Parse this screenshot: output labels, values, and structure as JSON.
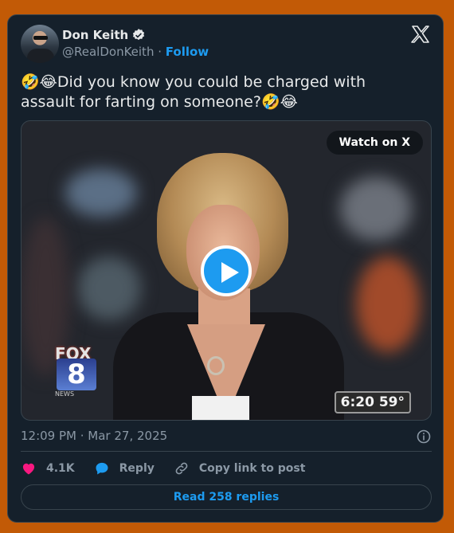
{
  "author": {
    "name": "Don Keith",
    "handle": "@RealDonKeith",
    "separator": " · ",
    "follow_label": "Follow",
    "verified": true
  },
  "tweet": {
    "text": "🤣😂Did you know you could be charged with assault for farting on someone?🤣😂"
  },
  "media": {
    "watch_label": "Watch on X",
    "overlay_text": {
      "fox": "FOX",
      "channel": "8",
      "news": "NEWS",
      "clock": "6:20 59°"
    }
  },
  "meta": {
    "timestamp": "12:09 PM · Mar 27, 2025"
  },
  "actions": {
    "likes_count": "4.1K",
    "reply_label": "Reply",
    "copy_label": "Copy link to post"
  },
  "read_replies_label": "Read 258 replies",
  "colors": {
    "page_bg": "#c25a06",
    "card_bg": "#15202b",
    "accent": "#1d9bf0",
    "like": "#f91880",
    "muted_text": "#8b98a5"
  },
  "icons": [
    "verified-icon",
    "x-logo-icon",
    "play-icon",
    "info-icon",
    "heart-icon",
    "reply-icon",
    "link-icon"
  ]
}
